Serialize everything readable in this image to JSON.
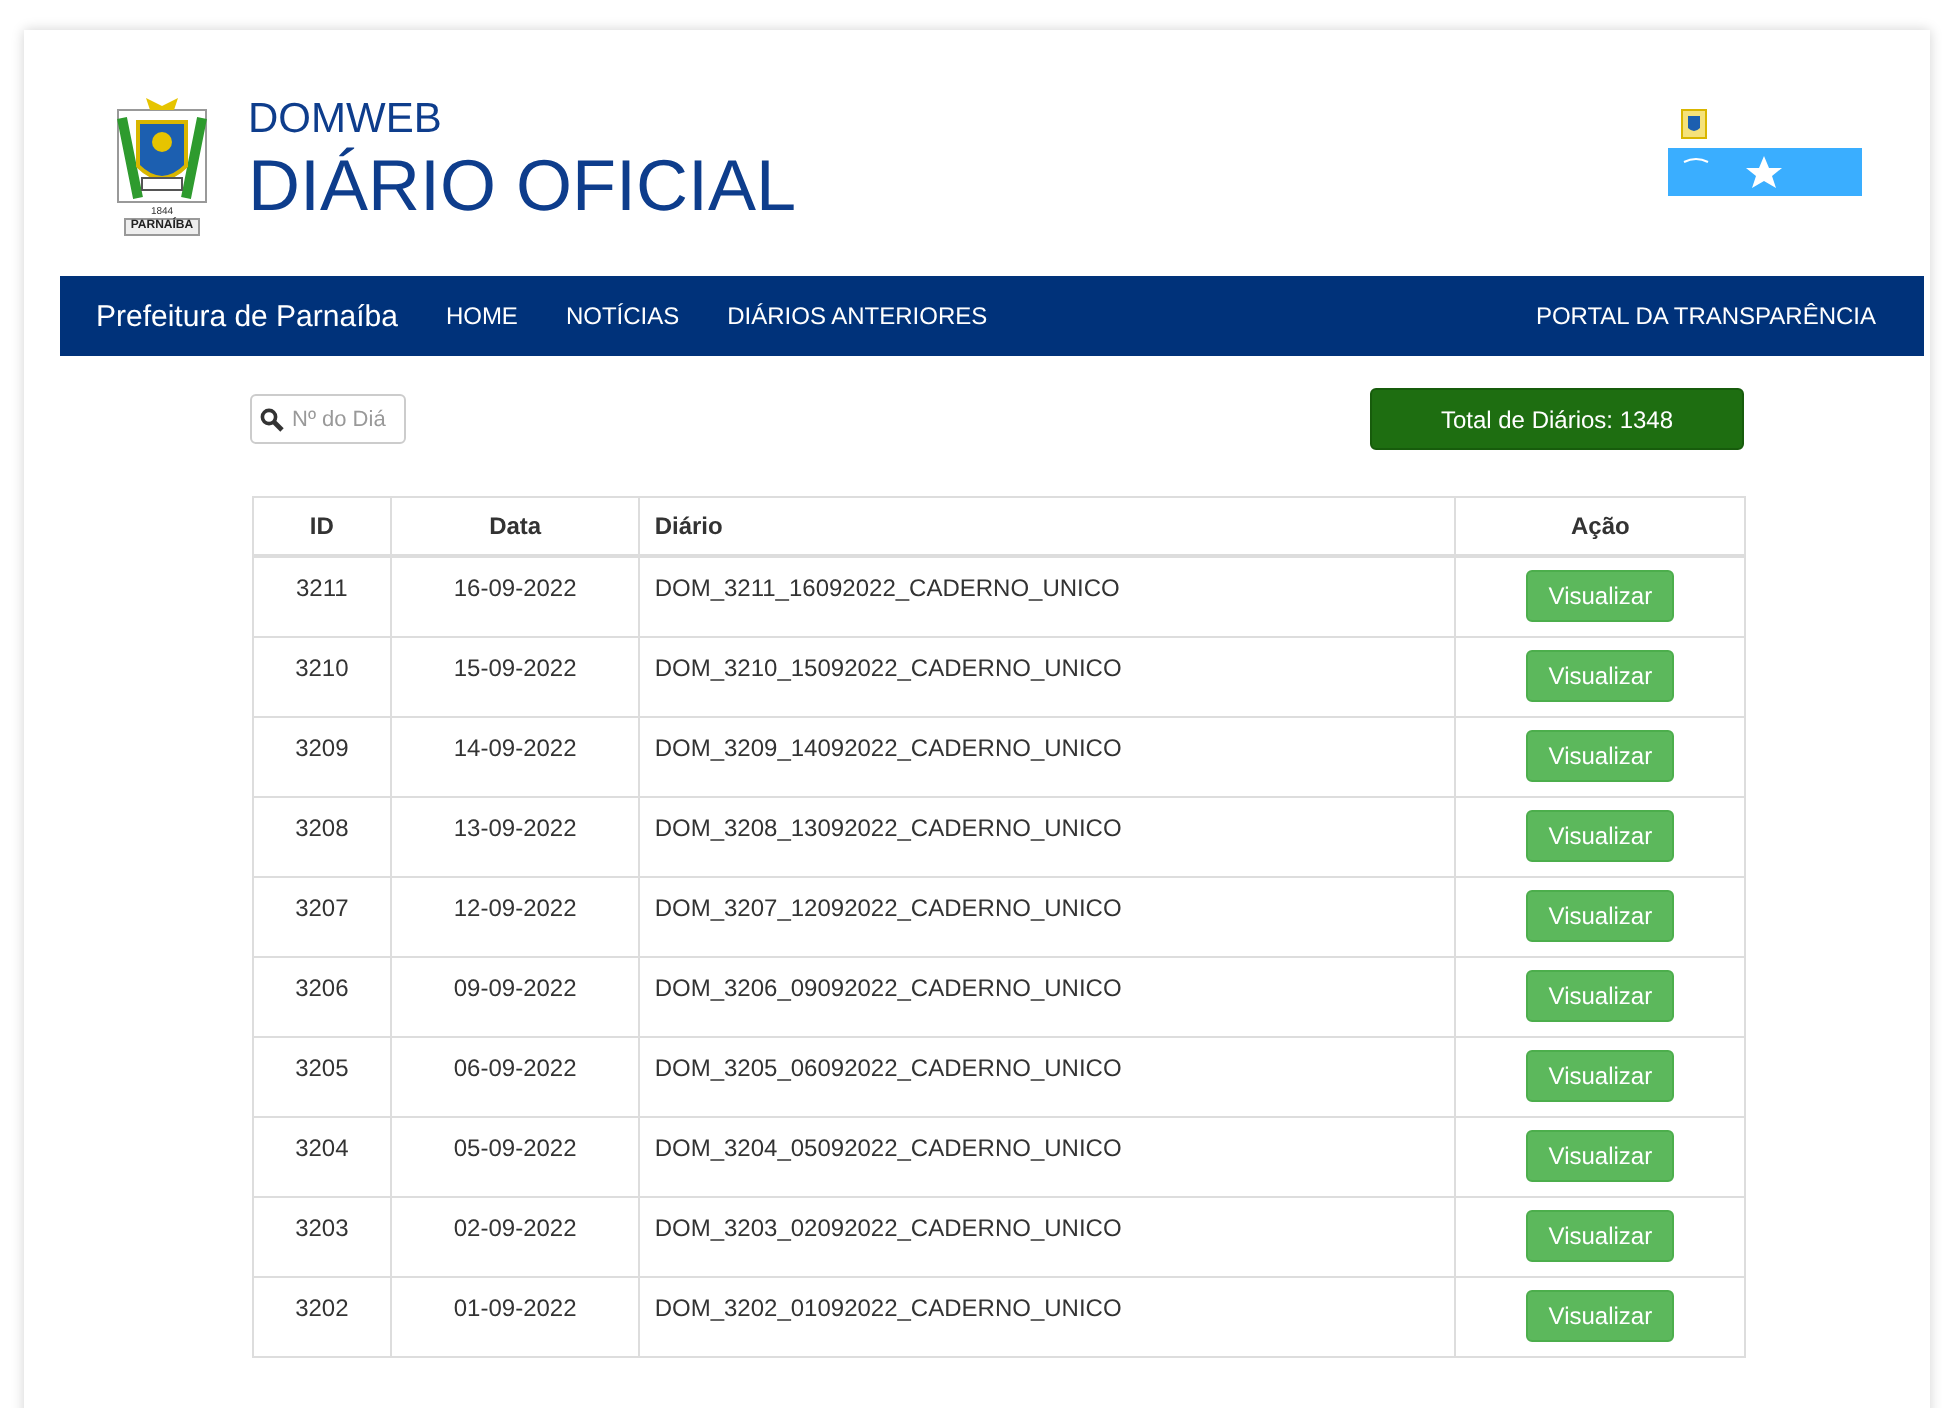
{
  "header": {
    "emblem_year": "1844",
    "emblem_ribbon": "PARNAÍBA",
    "subtitle": "DOMWEB",
    "title": "DIÁRIO OFICIAL"
  },
  "nav": {
    "brand": "Prefeitura de Parnaíba",
    "links": [
      "HOME",
      "NOTÍCIAS",
      "DIÁRIOS ANTERIORES"
    ],
    "right_link": "PORTAL DA TRANSPARÊNCIA"
  },
  "search": {
    "placeholder": "Nº do Diá"
  },
  "total": "Total de Diários: 1348",
  "table": {
    "columns": [
      "ID",
      "Data",
      "Diário",
      "Ação"
    ],
    "rows": [
      {
        "id": "3211",
        "date": "16-09-2022",
        "name": "DOM_3211_16092022_CADERNO_UNICO",
        "action": "Visualizar"
      },
      {
        "id": "3210",
        "date": "15-09-2022",
        "name": "DOM_3210_15092022_CADERNO_UNICO",
        "action": "Visualizar"
      },
      {
        "id": "3209",
        "date": "14-09-2022",
        "name": "DOM_3209_14092022_CADERNO_UNICO",
        "action": "Visualizar"
      },
      {
        "id": "3208",
        "date": "13-09-2022",
        "name": "DOM_3208_13092022_CADERNO_UNICO",
        "action": "Visualizar"
      },
      {
        "id": "3207",
        "date": "12-09-2022",
        "name": "DOM_3207_12092022_CADERNO_UNICO",
        "action": "Visualizar"
      },
      {
        "id": "3206",
        "date": "09-09-2022",
        "name": "DOM_3206_09092022_CADERNO_UNICO",
        "action": "Visualizar"
      },
      {
        "id": "3205",
        "date": "06-09-2022",
        "name": "DOM_3205_06092022_CADERNO_UNICO",
        "action": "Visualizar"
      },
      {
        "id": "3204",
        "date": "05-09-2022",
        "name": "DOM_3204_05092022_CADERNO_UNICO",
        "action": "Visualizar"
      },
      {
        "id": "3203",
        "date": "02-09-2022",
        "name": "DOM_3203_02092022_CADERNO_UNICO",
        "action": "Visualizar"
      },
      {
        "id": "3202",
        "date": "01-09-2022",
        "name": "DOM_3202_01092022_CADERNO_UNICO",
        "action": "Visualizar"
      }
    ]
  }
}
